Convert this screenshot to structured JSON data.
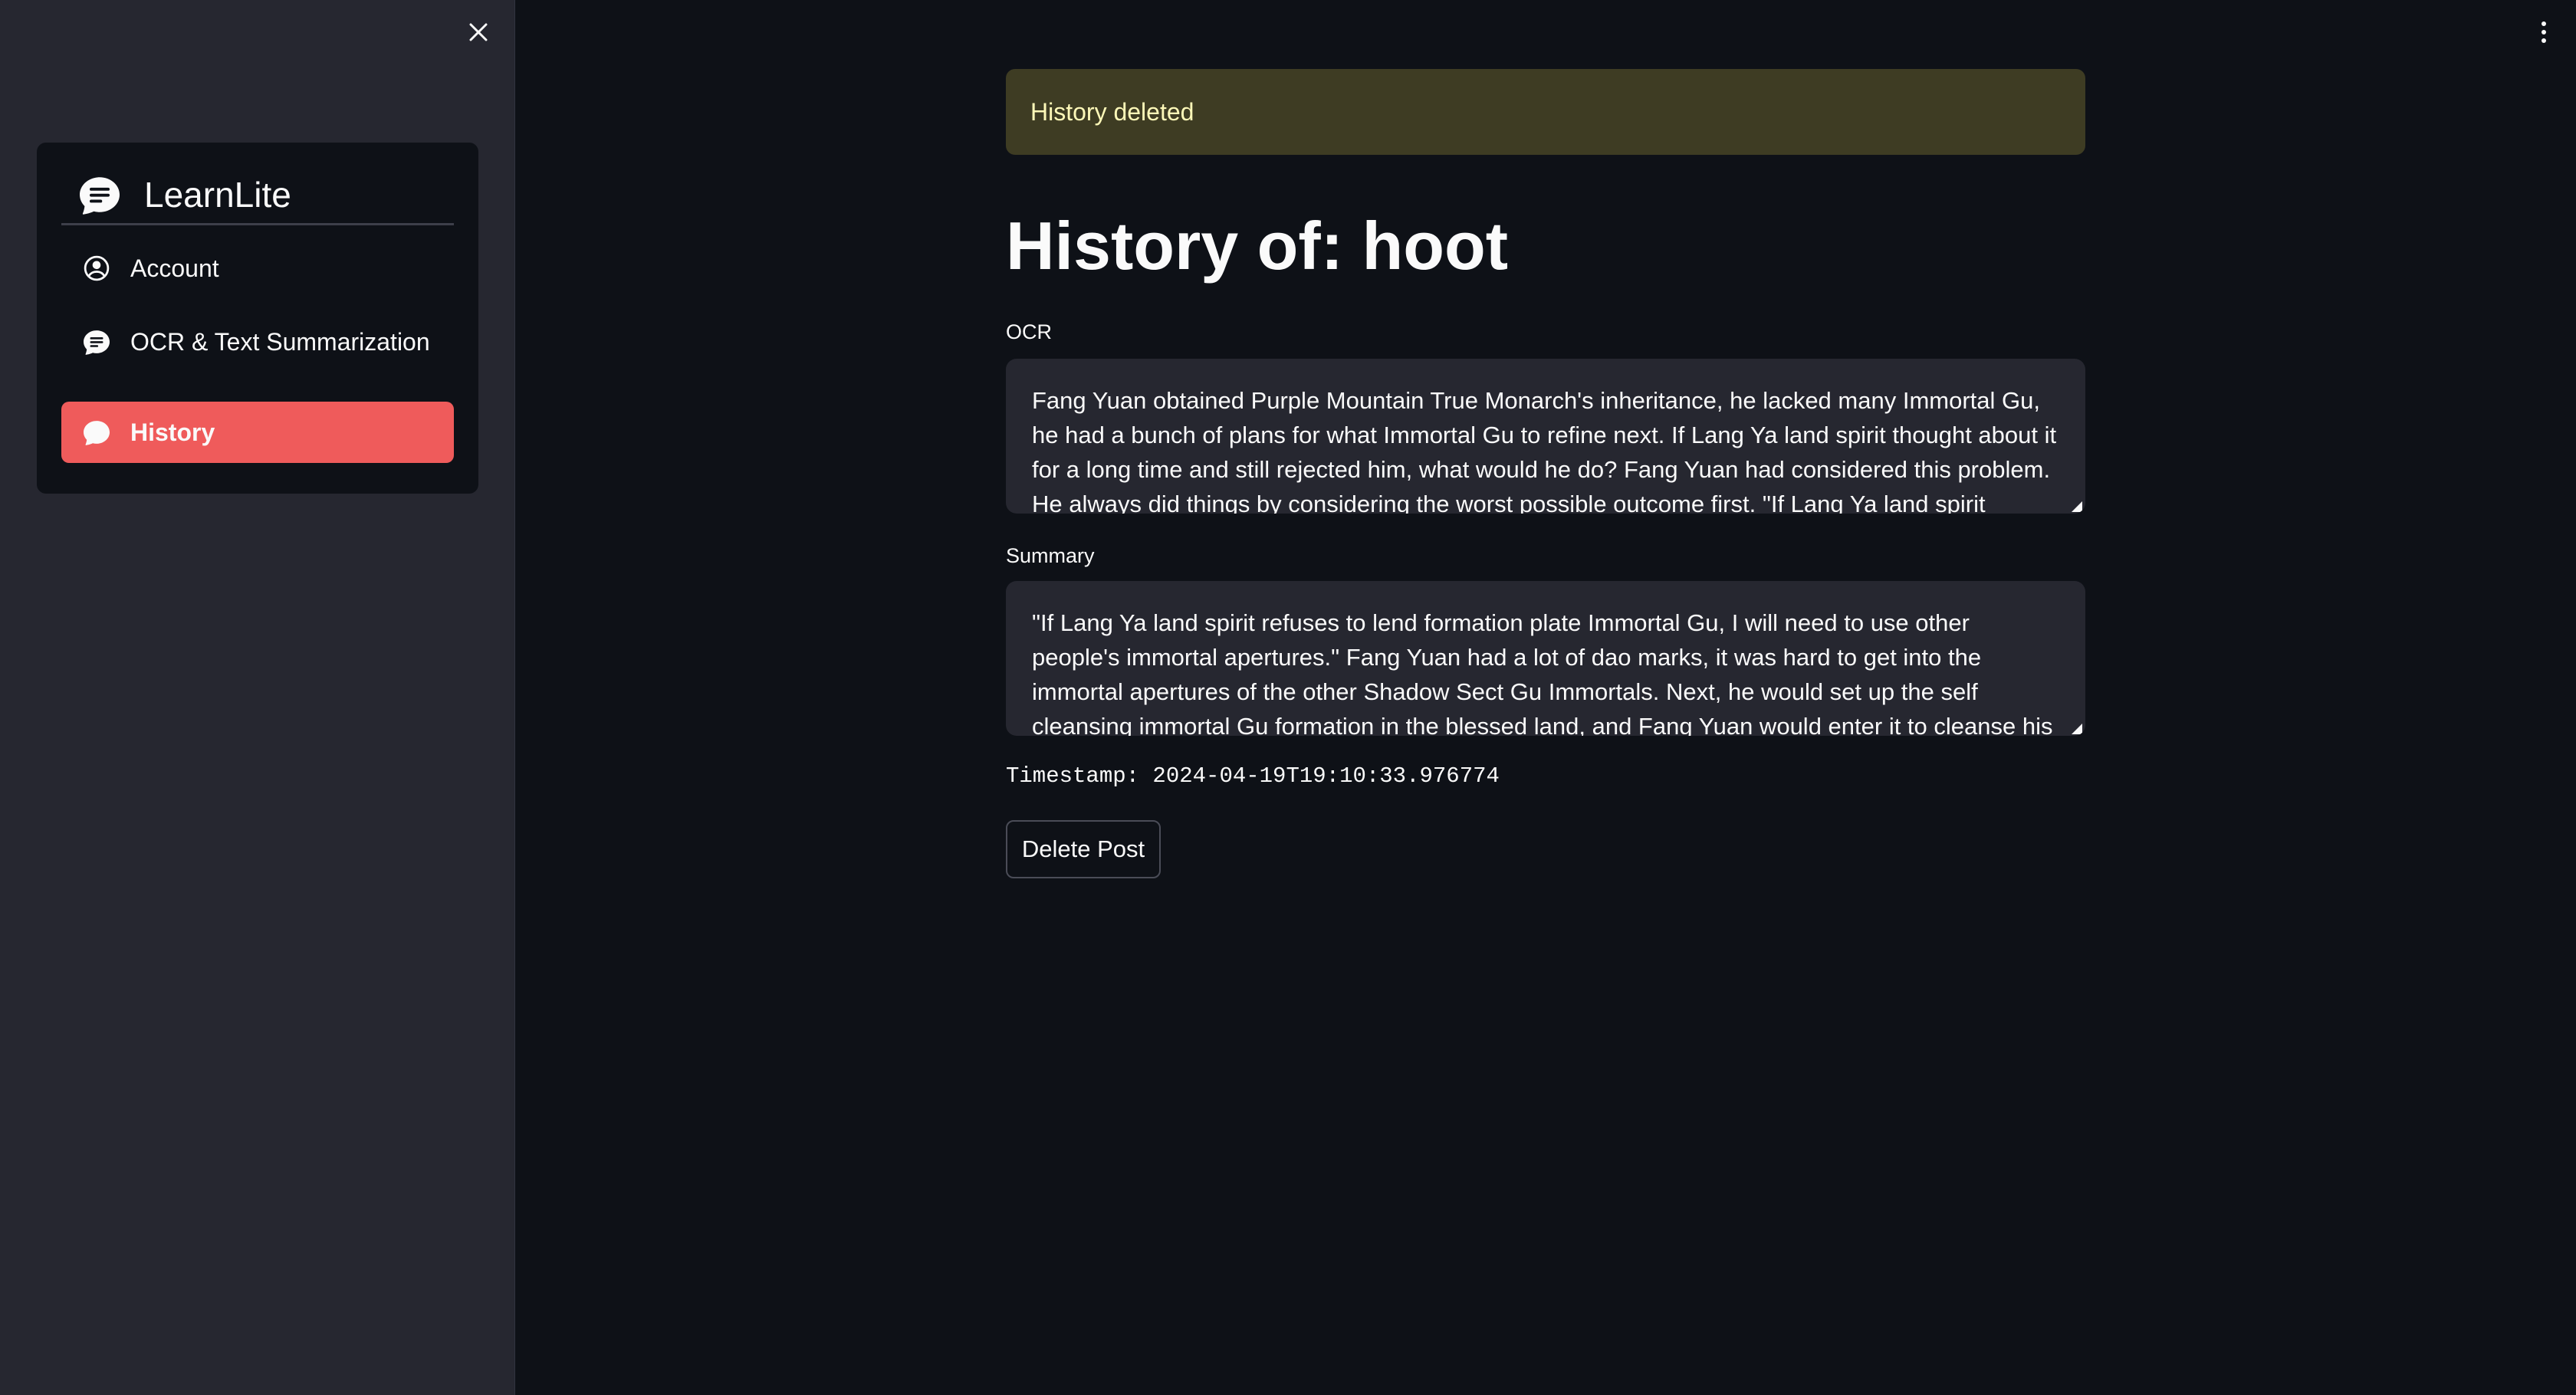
{
  "sidebar": {
    "close_icon": "close-icon",
    "brand": {
      "title": "LearnLite",
      "icon": "chat-bubble-icon"
    },
    "items": [
      {
        "label": "Account",
        "icon": "person-circle-icon",
        "active": false
      },
      {
        "label": "OCR & Text Summarization",
        "icon": "chat-bubble-icon",
        "active": false
      },
      {
        "label": "History",
        "icon": "chat-bubble-icon",
        "active": true
      }
    ]
  },
  "header": {
    "menu_icon": "vertical-dots-icon"
  },
  "main": {
    "alert": "History deleted",
    "title": "History of: hoot",
    "ocr": {
      "label": "OCR",
      "text": "Fang Yuan obtained Purple Mountain True Monarch's inheritance, he lacked many Immortal Gu, he had a bunch of plans for what Immortal Gu to refine next.  If Lang Ya land spirit thought about it for a long time and still rejected him, what would he do?  Fang Yuan had considered this problem.  He always did things by considering the worst possible outcome first.  \"If Lang Ya land spirit refuses to"
    },
    "summary": {
      "label": "Summary",
      "text": "\"If Lang Ya land spirit refuses to lend formation plate Immortal Gu, I will need to use other people's immortal apertures.\" Fang Yuan had a lot of dao marks, it was hard to get into the immortal apertures of the other Shadow Sect Gu Immortals. Next, he would set up the self cleansing immortal Gu formation in the blessed land, and Fang Yuan would enter it to cleanse his detrimental dao"
    },
    "timestamp": "Timestamp: 2024-04-19T19:10:33.976774",
    "delete_button": "Delete Post"
  },
  "colors": {
    "background": "#0e1117",
    "sidebar": "#262730",
    "accent": "#ef5b5b",
    "alert_bg": "#3e3c23",
    "alert_text": "#fdf8b8"
  }
}
